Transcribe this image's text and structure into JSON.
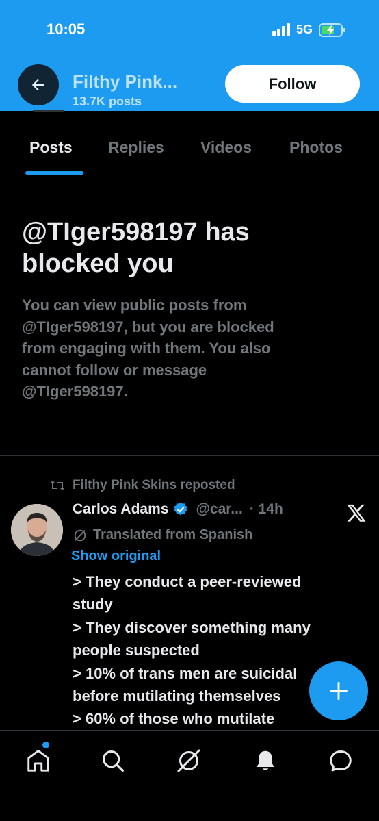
{
  "status_bar": {
    "time": "10:05",
    "network": "5G"
  },
  "header": {
    "name": "Filthy Pink...",
    "posts_count": "13.7K posts",
    "follow_label": "Follow"
  },
  "tabs": [
    {
      "label": "Posts",
      "active": true
    },
    {
      "label": "Replies",
      "active": false
    },
    {
      "label": "Videos",
      "active": false
    },
    {
      "label": "Photos",
      "active": false
    }
  ],
  "blocked_notice": {
    "title_lines": [
      "@TIger598197 has",
      "blocked you"
    ],
    "body_lines": [
      "You can view public posts from",
      "@TIger598197, but you are blocked",
      "from engaging with them. You also",
      "cannot follow or message",
      "@TIger598197."
    ]
  },
  "post": {
    "repost_label": "Filthy Pink Skins reposted",
    "author": "Carlos Adams",
    "handle": "@car...",
    "time": "· 14h",
    "translated_label": "Translated from Spanish",
    "show_original": "Show original",
    "text_lines": [
      "> They conduct a peer-reviewed",
      "study",
      "> They discover something many",
      "people suspected",
      "> 10% of trans men are suicidal",
      "before mutilating themselves",
      "> 60% of those who mutilate"
    ]
  },
  "colors": {
    "accent": "#1d9bf0",
    "background": "#000000",
    "muted_text": "#71767b",
    "primary_text": "#e7e9ea"
  },
  "icons": {
    "back": "arrow-left-icon",
    "repost": "repost-icon",
    "verified": "verified-badge-icon",
    "x_logo": "x-logo-icon",
    "translate": "translate-icon",
    "compose": "plus-icon",
    "nav": [
      "home-icon",
      "search-icon",
      "grok-icon",
      "notifications-icon",
      "messages-icon"
    ]
  }
}
